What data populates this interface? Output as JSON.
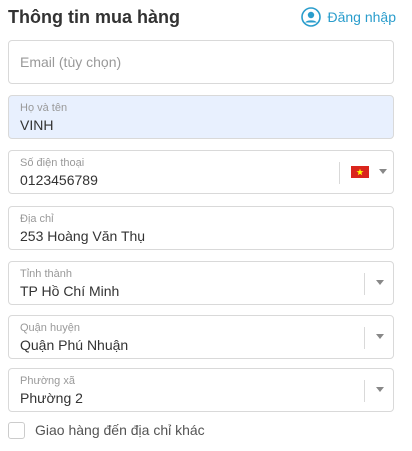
{
  "header": {
    "title": "Thông tin mua hàng",
    "login_label": "Đăng nhập"
  },
  "form": {
    "email": {
      "placeholder": "Email (tùy chọn)"
    },
    "name": {
      "label": "Họ và tên",
      "value": "VINH"
    },
    "phone": {
      "label": "Số điện thoại",
      "value": "0123456789",
      "country_flag": "vietnam-flag-icon"
    },
    "address": {
      "label": "Địa chỉ",
      "value": "253 Hoàng Văn Thụ"
    },
    "province": {
      "label": "Tỉnh thành",
      "value": "TP Hồ Chí Minh"
    },
    "district": {
      "label": "Quận huyện",
      "value": "Quận Phú Nhuận"
    },
    "ward": {
      "label": "Phường xã",
      "value": "Phường 2"
    },
    "ship_other": {
      "label": "Giao hàng đến địa chỉ khác",
      "checked": false
    }
  },
  "colors": {
    "accent": "#2a9dcc",
    "autofill_bg": "#e8f0fe",
    "border": "#d9d9d9",
    "flag_red": "#da251d",
    "flag_star": "#ffff00"
  }
}
